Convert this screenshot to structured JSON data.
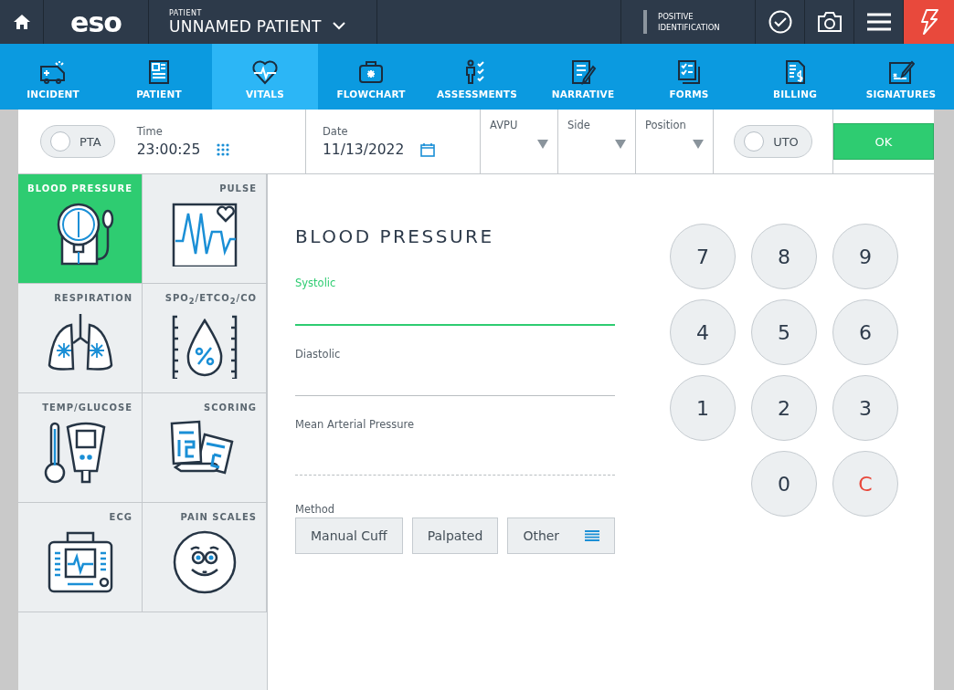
{
  "topbar": {
    "logo": "eso",
    "patient_label": "PATIENT",
    "patient_name": "UNNAMED PATIENT",
    "identification": "POSITIVE IDENTIFICATION"
  },
  "nav": [
    {
      "label": "INCIDENT",
      "kind": "ambulance",
      "selected": false
    },
    {
      "label": "PATIENT",
      "kind": "idcard",
      "selected": false
    },
    {
      "label": "VITALS",
      "kind": "heart",
      "selected": true
    },
    {
      "label": "FLOWCHART",
      "kind": "bag",
      "selected": false
    },
    {
      "label": "ASSESSMENTS",
      "kind": "person",
      "selected": false
    },
    {
      "label": "NARRATIVE",
      "kind": "doc",
      "selected": false
    },
    {
      "label": "FORMS",
      "kind": "forms",
      "selected": false
    },
    {
      "label": "BILLING",
      "kind": "bill",
      "selected": false
    },
    {
      "label": "SIGNATURES",
      "kind": "sign",
      "selected": false
    }
  ],
  "toolbar": {
    "pta": {
      "label": "PTA",
      "on": false
    },
    "time": {
      "label": "Time",
      "value": "23:00:25"
    },
    "date": {
      "label": "Date",
      "value": "11/13/2022"
    },
    "dropdowns": [
      {
        "label": "AVPU"
      },
      {
        "label": "Side"
      },
      {
        "label": "Position"
      }
    ],
    "uto": {
      "label": "UTO",
      "on": false
    },
    "ok": "OK"
  },
  "categories": [
    {
      "label": "BLOOD PRESSURE",
      "kind": "bp",
      "selected": true
    },
    {
      "label": "PULSE",
      "kind": "pulse",
      "selected": false
    },
    {
      "label": "RESPIRATION",
      "kind": "lungs",
      "selected": false
    },
    {
      "label": "SPO$_{2}$/ETCO$_{2}$/CO",
      "kind": "drop",
      "selected": false
    },
    {
      "label": "TEMP/GLUCOSE",
      "kind": "thermo",
      "selected": false
    },
    {
      "label": "SCORING",
      "kind": "score",
      "selected": false
    },
    {
      "label": "ECG",
      "kind": "ecg",
      "selected": false
    },
    {
      "label": "PAIN SCALES",
      "kind": "face",
      "selected": false
    }
  ],
  "form": {
    "title": "BLOOD PRESSURE",
    "fields": [
      {
        "label": "Systolic",
        "kind": "input",
        "focused": true
      },
      {
        "label": "Diastolic",
        "kind": "input",
        "focused": false
      },
      {
        "label": "Mean Arterial Pressure",
        "kind": "computed"
      }
    ],
    "method_label": "Method",
    "methods": [
      {
        "label": "Manual Cuff",
        "kind": "option"
      },
      {
        "label": "Palpated",
        "kind": "option"
      },
      {
        "label": "Other",
        "kind": "list"
      }
    ]
  },
  "keypad": [
    {
      "label": "7",
      "kind": "digit"
    },
    {
      "label": "8",
      "kind": "digit"
    },
    {
      "label": "9",
      "kind": "digit"
    },
    {
      "label": "4",
      "kind": "digit"
    },
    {
      "label": "5",
      "kind": "digit"
    },
    {
      "label": "6",
      "kind": "digit"
    },
    {
      "label": "1",
      "kind": "digit"
    },
    {
      "label": "2",
      "kind": "digit"
    },
    {
      "label": "3",
      "kind": "digit"
    },
    {
      "label": "0",
      "kind": "digit"
    },
    {
      "label": "C",
      "kind": "clear"
    }
  ]
}
